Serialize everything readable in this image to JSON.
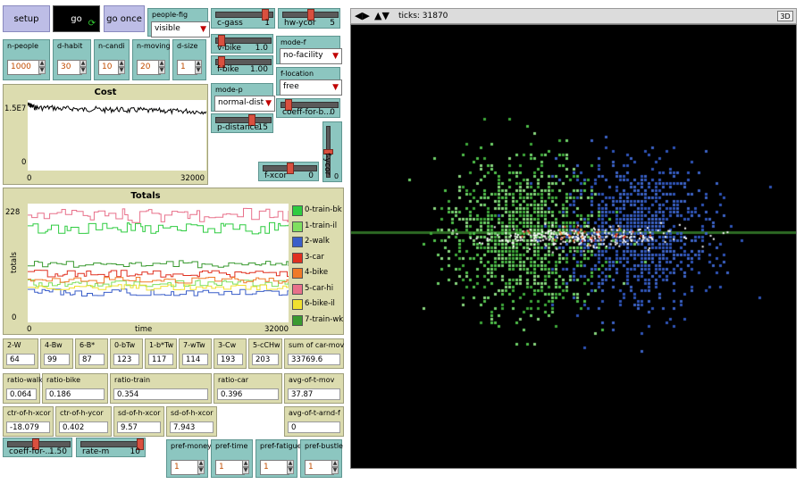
{
  "buttons": {
    "setup": "setup",
    "go": "go",
    "go_once": "go once"
  },
  "inputs": [
    {
      "label": "n-people",
      "value": "1000"
    },
    {
      "label": "d-habit",
      "value": "30"
    },
    {
      "label": "n-candi",
      "value": "10"
    },
    {
      "label": "n-moving",
      "value": "20"
    },
    {
      "label": "d-size",
      "value": "1"
    }
  ],
  "choosers": {
    "people_fig": {
      "label": "people-fig",
      "value": "visible"
    },
    "mode_f": {
      "label": "mode-f",
      "value": "no-facility"
    },
    "f_location": {
      "label": "f-location",
      "value": "free"
    },
    "mode_p": {
      "label": "mode-p",
      "value": "normal-dist"
    }
  },
  "sliders": {
    "c_gass": {
      "label": "c-gass",
      "value": "1",
      "fraction": 0.92
    },
    "hw_ycor": {
      "label": "hw-ycor",
      "value": "5",
      "fraction": 0.5
    },
    "v_bike": {
      "label": "v-bike",
      "value": "1.0",
      "fraction": 0.05
    },
    "f_bike": {
      "label": "f-bike",
      "value": "1.00",
      "fraction": 0.05
    },
    "coeff_for_b": {
      "label": "coeff-for-b...",
      "value": "0",
      "fraction": 0.08
    },
    "p_distance": {
      "label": "p-distance",
      "value": "15",
      "fraction": 0.68
    },
    "f_xcor": {
      "label": "f-xcor",
      "value": "0",
      "fraction": 0.5
    },
    "f_ycor": {
      "label": "f-ycor",
      "value": "0",
      "fraction": 0.5
    },
    "coeff_for_bottom": {
      "label": "coeff-for-...",
      "value": "1.50",
      "fraction": 0.45
    },
    "rate_m": {
      "label": "rate-m",
      "value": "10",
      "fraction": 1.0
    }
  },
  "cost_plot": {
    "title": "Cost",
    "y_max": "1.5E7",
    "y_min": "0",
    "x_min": "0",
    "x_max": "32000",
    "points": [
      [
        0,
        15000000.0
      ],
      [
        500,
        14800000.0
      ],
      [
        1000,
        14400000.0
      ],
      [
        2000,
        14200000.0
      ],
      [
        4000,
        14300000.0
      ],
      [
        6000,
        14000000.0
      ],
      [
        8000,
        14100000.0
      ],
      [
        10000,
        13800000.0
      ],
      [
        12000,
        14000000.0
      ],
      [
        14000,
        13700000.0
      ],
      [
        16000,
        13900000.0
      ],
      [
        18000,
        13600000.0
      ],
      [
        20000,
        13800000.0
      ],
      [
        22000,
        13500000.0
      ],
      [
        24000,
        13600000.0
      ],
      [
        26000,
        13400000.0
      ],
      [
        28000,
        13500000.0
      ],
      [
        30000,
        13400000.0
      ],
      [
        32000,
        13400000.0
      ]
    ]
  },
  "totals_plot": {
    "title": "Totals",
    "ylabel": "totals",
    "xlabel": "time",
    "y_max": "228",
    "y_min": "0",
    "x_min": "0",
    "x_max": "32000",
    "legend": [
      {
        "name": "0-train-bk",
        "color": "#2ecc40"
      },
      {
        "name": "1-train-il",
        "color": "#7fdf5f"
      },
      {
        "name": "2-walk",
        "color": "#3b5fc9"
      },
      {
        "name": "3-car",
        "color": "#e03020"
      },
      {
        "name": "4-bike",
        "color": "#f07a28"
      },
      {
        "name": "5-car-hi",
        "color": "#e8708a"
      },
      {
        "name": "6-bike-il",
        "color": "#f0e030"
      },
      {
        "name": "7-train-wk",
        "color": "#3a9a30"
      }
    ],
    "series_levels": [
      [
        0.74,
        0.84
      ],
      [
        0.3,
        0.36
      ],
      [
        0.22,
        0.28
      ],
      [
        0.38,
        0.44
      ],
      [
        0.33,
        0.38
      ],
      [
        0.84,
        0.96
      ],
      [
        0.27,
        0.32
      ],
      [
        0.46,
        0.52
      ]
    ]
  },
  "monitors_row1": [
    {
      "label": "2-W",
      "value": "64"
    },
    {
      "label": "4-Bw",
      "value": "99"
    },
    {
      "label": "6-B*",
      "value": "87"
    },
    {
      "label": "0-bTw",
      "value": "123"
    },
    {
      "label": "1-b*Tw",
      "value": "117"
    },
    {
      "label": "7-wTw",
      "value": "114"
    },
    {
      "label": "3-Cw",
      "value": "193"
    },
    {
      "label": "5-cCHw",
      "value": "203"
    },
    {
      "label": "sum of car-mov",
      "value": "33769.6"
    }
  ],
  "monitors_row2": [
    {
      "label": "ratio-walk",
      "value": "0.064"
    },
    {
      "label": "ratio-bike",
      "value": "0.186"
    },
    {
      "label": "ratio-train",
      "value": "0.354"
    },
    {
      "label": "ratio-car",
      "value": "0.396"
    },
    {
      "label": "avg-of-t-mov",
      "value": "37.87"
    }
  ],
  "monitors_row3": [
    {
      "label": "ctr-of-h-xcor",
      "value": "-18.079"
    },
    {
      "label": "ctr-of-h-ycor",
      "value": "0.402"
    },
    {
      "label": "sd-of-h-xcor",
      "value": "9.57"
    },
    {
      "label": "sd-of-h-xcor",
      "value": "7.943"
    },
    {
      "label": "avg-of-t-arnd-f",
      "value": "0"
    }
  ],
  "pref_inputs": [
    {
      "label": "pref-money",
      "value": "1"
    },
    {
      "label": "pref-time",
      "value": "1"
    },
    {
      "label": "pref-fatigue",
      "value": "1"
    },
    {
      "label": "pref-bustle",
      "value": "1"
    }
  ],
  "view": {
    "ticks_label": "ticks: 31870",
    "btn_3d": "3D",
    "background": "#000000"
  }
}
